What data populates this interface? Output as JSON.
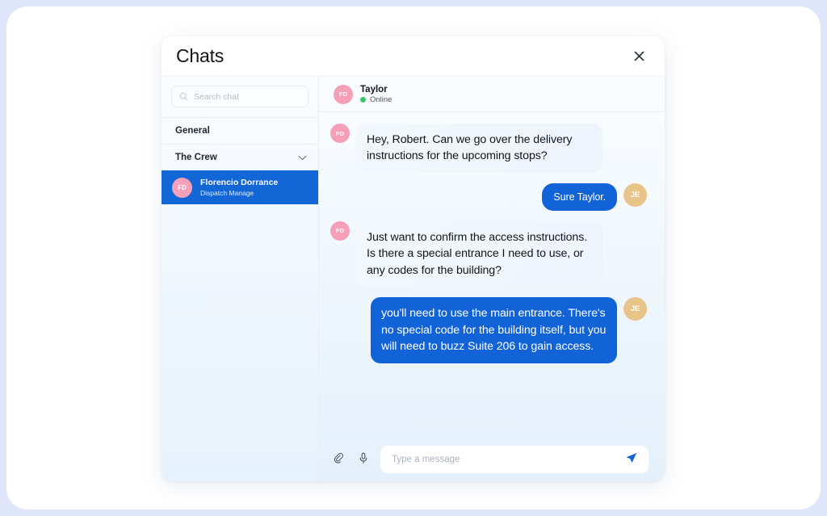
{
  "modal": {
    "title": "Chats",
    "close_icon": "close-icon"
  },
  "sidebar": {
    "search": {
      "placeholder": "Search chat",
      "value": "",
      "icon": "search-icon"
    },
    "groups": [
      {
        "label": "General",
        "has_chevron": false
      },
      {
        "label": "The Crew",
        "has_chevron": true,
        "chevron_icon": "chevron-down-icon"
      }
    ],
    "contacts": [
      {
        "initials": "FD",
        "name": "Florencio Dorrance",
        "role": "Dispatch Manage",
        "selected": true,
        "avatar_color": "#f5a0b8",
        "selected_color": "#1366d6"
      }
    ]
  },
  "chat": {
    "peer": {
      "initials": "FD",
      "name": "Taylor",
      "status": "Online",
      "status_color": "#3ec46d",
      "avatar_color": "#f5a0b8"
    },
    "messages": [
      {
        "direction": "in",
        "avatar_initials": "FD",
        "text": "Hey, Robert. Can we go over the delivery instructions for the upcoming stops?"
      },
      {
        "direction": "out",
        "avatar_initials": "JE",
        "text": "Sure Taylor."
      },
      {
        "direction": "in",
        "avatar_initials": "FD",
        "text": "Just want to confirm the access instructions. Is there a special entrance I need to use, or any codes for the building?"
      },
      {
        "direction": "out",
        "avatar_initials": "JE",
        "text": "you'll need to use the main entrance. There's no special code for the building itself, but you will need to buzz Suite 206 to gain access."
      }
    ],
    "composer": {
      "attach_icon": "paperclip-icon",
      "mic_icon": "microphone-icon",
      "placeholder": "Type a message",
      "value": "",
      "send_icon": "send-icon",
      "send_color": "#1263d8"
    }
  },
  "theme": {
    "accent": "#1263d8",
    "page_background": "#dfe6fb",
    "card_background": "#ffffff"
  }
}
